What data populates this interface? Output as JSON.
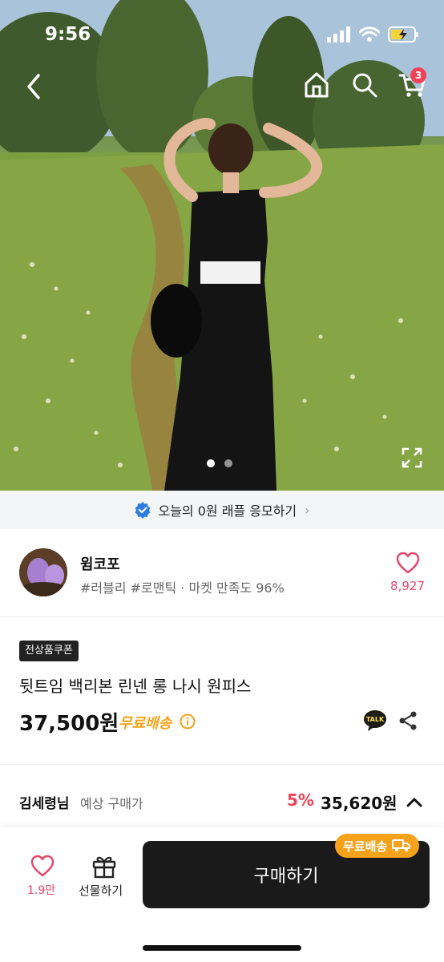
{
  "status": {
    "time": "9:56"
  },
  "nav": {
    "cart_count": "3"
  },
  "raffle": {
    "text": "오늘의 0원 래플 응모하기"
  },
  "seller": {
    "name": "윔코포",
    "meta": "#러블리 #로맨틱 · 마켓 만족도 96%",
    "likes": "8,927"
  },
  "product": {
    "coupon_tag": "전상품쿠폰",
    "title": "뒷트임 백리본 린넨 롱 나시 원피스",
    "price": "37,500원",
    "free_shipping": "무료배송",
    "talk_label": "TALK"
  },
  "expected": {
    "user": "김세령님",
    "label": "예상 구매가",
    "discount": "5%",
    "price": "35,620원"
  },
  "bottom": {
    "wish_count": "1.9만",
    "gift_label": "선물하기",
    "buy_label": "구매하기",
    "ship_badge": "무료배송"
  },
  "colors": {
    "accent_pink": "#e8456a",
    "discount_red": "#f04257",
    "shipping_orange": "#f6a21a",
    "buy_button": "#1a1a1a"
  }
}
